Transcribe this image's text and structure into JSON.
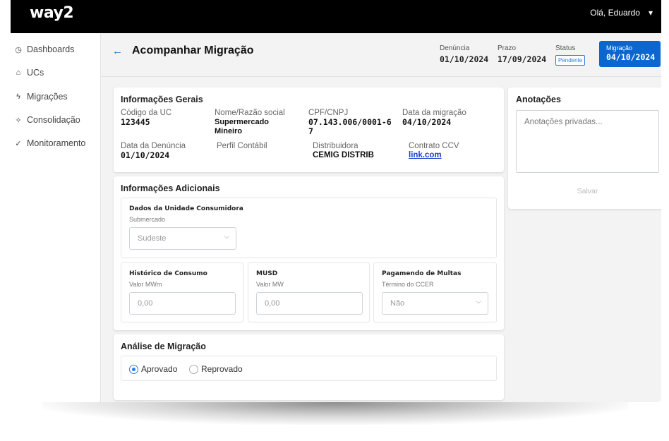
{
  "topbar": {
    "logo": "way2",
    "greeting": "Olá, Eduardo",
    "chevron": "▾"
  },
  "sidebar": {
    "items": [
      {
        "label": "Dashboards",
        "icon": "dashboard-icon",
        "glyph": "◷"
      },
      {
        "label": "UCs",
        "icon": "home-icon",
        "glyph": "⌂"
      },
      {
        "label": "Migrações",
        "icon": "bolt-icon",
        "glyph": "ϟ"
      },
      {
        "label": "Consolidação",
        "icon": "sparkle-icon",
        "glyph": "✧"
      },
      {
        "label": "Monitoramento",
        "icon": "check-circle-icon",
        "glyph": "✓"
      }
    ]
  },
  "header": {
    "back": "←",
    "title": "Acompanhar Migração",
    "denuncia_label": "Denúncia",
    "denuncia_value": "01/10/2024",
    "prazo_label": "Prazo",
    "prazo_value": "17/09/2024",
    "status_label": "Status",
    "status_value": "Pendente",
    "migracao_label": "Migração",
    "migracao_value": "04/10/2024",
    "accent": "#0a66d1"
  },
  "gerais": {
    "title": "Informações Gerais",
    "codigo_label": "Código da UC",
    "codigo_value": "123445",
    "nome_label": "Nome/Razão social",
    "nome_value": "Supermercado Mineiro",
    "cpf_label": "CPF/CNPJ",
    "cpf_value": "07.143.006/0001-67",
    "data_mig_label": "Data da migração",
    "data_mig_value": "04/10/2024",
    "data_den_label": "Data da Denúncia",
    "data_den_value": "01/10/2024",
    "perfil_label": "Perfil Contábil",
    "distribuidora_label": "Distribuidora",
    "distribuidora_value": "CEMIG DISTRIB",
    "contrato_label": "Contrato CCV",
    "contrato_value": "link.com"
  },
  "adicionais": {
    "title": "Informações Adicionais",
    "dados_title": "Dados da Unidade Consumidora",
    "submercado_label": "Submercado",
    "submercado_value": "Sudeste",
    "historico_title": "Histórico de Consumo",
    "historico_label": "Valor MWm",
    "historico_placeholder": "0,00",
    "musd_title": "MUSD",
    "musd_label": "Valor MW",
    "musd_placeholder": "0,00",
    "multas_title": "Pagamendo de Multas",
    "multas_label": "Término do CCER",
    "multas_value": "Não"
  },
  "analise": {
    "title": "Análise de Migração",
    "aprovado": "Aprovado",
    "reprovado": "Reprovado",
    "selected": "Aprovado"
  },
  "anotacoes": {
    "title": "Anotações",
    "placeholder": "Anotações privadas...",
    "save": "Salvar"
  }
}
